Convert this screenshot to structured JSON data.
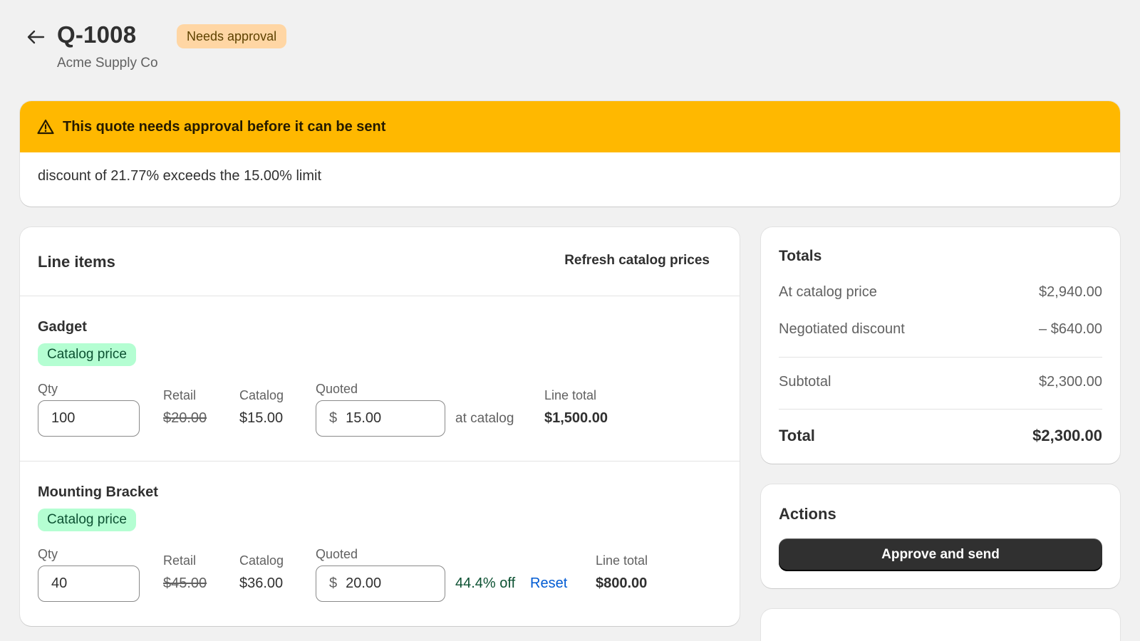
{
  "header": {
    "title": "Q-1008",
    "status_badge": "Needs approval",
    "customer": "Acme Supply Co"
  },
  "banner": {
    "title": "This quote needs approval before it can be sent",
    "message": "discount of 21.77% exceeds the 15.00% limit"
  },
  "line_items": {
    "title": "Line items",
    "refresh_label": "Refresh catalog prices",
    "labels": {
      "qty": "Qty",
      "retail": "Retail",
      "catalog": "Catalog",
      "quoted": "Quoted",
      "line_total": "Line total",
      "currency_prefix": "$"
    },
    "items": [
      {
        "name": "Gadget",
        "badge": "Catalog price",
        "qty": "100",
        "retail": "$20.00",
        "catalog": "$15.00",
        "quoted": "15.00",
        "price_note": "at catalog",
        "line_total": "$1,500.00"
      },
      {
        "name": "Mounting Bracket",
        "badge": "Catalog price",
        "qty": "40",
        "retail": "$45.00",
        "catalog": "$36.00",
        "quoted": "20.00",
        "price_note": "44.4% off",
        "reset_label": "Reset",
        "line_total": "$800.00"
      }
    ]
  },
  "totals": {
    "title": "Totals",
    "at_catalog_label": "At catalog price",
    "at_catalog_value": "$2,940.00",
    "discount_label": "Negotiated discount",
    "discount_value": "– $640.00",
    "subtotal_label": "Subtotal",
    "subtotal_value": "$2,300.00",
    "total_label": "Total",
    "total_value": "$2,300.00"
  },
  "actions": {
    "title": "Actions",
    "approve_label": "Approve and send"
  },
  "colors": {
    "warning_banner": "#ffb800",
    "warning_badge": "#ffd6a4",
    "success_badge": "#b4fed2",
    "link": "#005bd3",
    "primary_button": "#303030"
  }
}
